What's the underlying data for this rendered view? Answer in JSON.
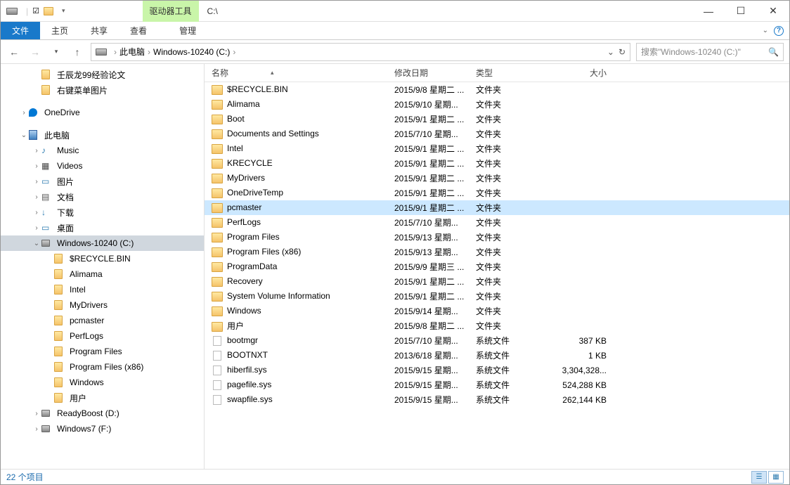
{
  "title": "C:\\",
  "tools_tab": "驱动器工具",
  "ribbon": {
    "file": "文件",
    "home": "主页",
    "share": "共享",
    "view": "查看",
    "manage": "管理"
  },
  "breadcrumb": {
    "pc": "此电脑",
    "drive": "Windows-10240 (C:)"
  },
  "search_placeholder": "搜索\"Windows-10240 (C:)\"",
  "columns": {
    "name": "名称",
    "date": "修改日期",
    "type": "类型",
    "size": "大小"
  },
  "tree": [
    {
      "indent": 2,
      "icon": "folder",
      "label": "壬辰龙99经验论文"
    },
    {
      "indent": 2,
      "icon": "folder",
      "label": "右键菜单图片"
    },
    {
      "spacer": true
    },
    {
      "indent": 1,
      "icon": "od",
      "label": "OneDrive",
      "expander": ">"
    },
    {
      "spacer": true
    },
    {
      "indent": 1,
      "icon": "pc",
      "label": "此电脑",
      "expander": "v"
    },
    {
      "indent": 2,
      "icon": "music",
      "label": "Music",
      "expander": ">"
    },
    {
      "indent": 2,
      "icon": "video",
      "label": "Videos",
      "expander": ">"
    },
    {
      "indent": 2,
      "icon": "pic",
      "label": "图片",
      "expander": ">"
    },
    {
      "indent": 2,
      "icon": "doc",
      "label": "文档",
      "expander": ">"
    },
    {
      "indent": 2,
      "icon": "dl",
      "label": "下载",
      "expander": ">"
    },
    {
      "indent": 2,
      "icon": "desk",
      "label": "桌面",
      "expander": ">"
    },
    {
      "indent": 2,
      "icon": "drive",
      "label": "Windows-10240 (C:)",
      "expander": "v",
      "selected": true
    },
    {
      "indent": 3,
      "icon": "folder",
      "label": "$RECYCLE.BIN"
    },
    {
      "indent": 3,
      "icon": "folder",
      "label": "Alimama"
    },
    {
      "indent": 3,
      "icon": "folder",
      "label": "Intel"
    },
    {
      "indent": 3,
      "icon": "folder",
      "label": "MyDrivers"
    },
    {
      "indent": 3,
      "icon": "folder",
      "label": "pcmaster"
    },
    {
      "indent": 3,
      "icon": "folder",
      "label": "PerfLogs"
    },
    {
      "indent": 3,
      "icon": "folder",
      "label": "Program Files"
    },
    {
      "indent": 3,
      "icon": "folder",
      "label": "Program Files (x86)"
    },
    {
      "indent": 3,
      "icon": "folder",
      "label": "Windows"
    },
    {
      "indent": 3,
      "icon": "folder",
      "label": "用户"
    },
    {
      "indent": 2,
      "icon": "drive",
      "label": "ReadyBoost (D:)",
      "expander": ">"
    },
    {
      "indent": 2,
      "icon": "drive",
      "label": "Windows7 (F:)",
      "expander": ">"
    }
  ],
  "files": [
    {
      "icon": "folder",
      "name": "$RECYCLE.BIN",
      "date": "2015/9/8 星期二 ...",
      "type": "文件夹",
      "size": ""
    },
    {
      "icon": "folder",
      "name": "Alimama",
      "date": "2015/9/10 星期...",
      "type": "文件夹",
      "size": ""
    },
    {
      "icon": "folder",
      "name": "Boot",
      "date": "2015/9/1 星期二 ...",
      "type": "文件夹",
      "size": ""
    },
    {
      "icon": "folder",
      "name": "Documents and Settings",
      "date": "2015/7/10 星期...",
      "type": "文件夹",
      "size": ""
    },
    {
      "icon": "folder",
      "name": "Intel",
      "date": "2015/9/1 星期二 ...",
      "type": "文件夹",
      "size": ""
    },
    {
      "icon": "folder",
      "name": "KRECYCLE",
      "date": "2015/9/1 星期二 ...",
      "type": "文件夹",
      "size": ""
    },
    {
      "icon": "folder",
      "name": "MyDrivers",
      "date": "2015/9/1 星期二 ...",
      "type": "文件夹",
      "size": ""
    },
    {
      "icon": "folder",
      "name": "OneDriveTemp",
      "date": "2015/9/1 星期二 ...",
      "type": "文件夹",
      "size": ""
    },
    {
      "icon": "folder",
      "name": "pcmaster",
      "date": "2015/9/1 星期二 ...",
      "type": "文件夹",
      "size": "",
      "selected": true
    },
    {
      "icon": "folder",
      "name": "PerfLogs",
      "date": "2015/7/10 星期...",
      "type": "文件夹",
      "size": ""
    },
    {
      "icon": "folder",
      "name": "Program Files",
      "date": "2015/9/13 星期...",
      "type": "文件夹",
      "size": ""
    },
    {
      "icon": "folder",
      "name": "Program Files (x86)",
      "date": "2015/9/13 星期...",
      "type": "文件夹",
      "size": ""
    },
    {
      "icon": "folder",
      "name": "ProgramData",
      "date": "2015/9/9 星期三 ...",
      "type": "文件夹",
      "size": ""
    },
    {
      "icon": "folder",
      "name": "Recovery",
      "date": "2015/9/1 星期二 ...",
      "type": "文件夹",
      "size": ""
    },
    {
      "icon": "folder",
      "name": "System Volume Information",
      "date": "2015/9/1 星期二 ...",
      "type": "文件夹",
      "size": ""
    },
    {
      "icon": "folder",
      "name": "Windows",
      "date": "2015/9/14 星期...",
      "type": "文件夹",
      "size": ""
    },
    {
      "icon": "folder",
      "name": "用户",
      "date": "2015/9/8 星期二 ...",
      "type": "文件夹",
      "size": ""
    },
    {
      "icon": "file",
      "name": "bootmgr",
      "date": "2015/7/10 星期...",
      "type": "系统文件",
      "size": "387 KB"
    },
    {
      "icon": "file",
      "name": "BOOTNXT",
      "date": "2013/6/18 星期...",
      "type": "系统文件",
      "size": "1 KB"
    },
    {
      "icon": "file",
      "name": "hiberfil.sys",
      "date": "2015/9/15 星期...",
      "type": "系统文件",
      "size": "3,304,328..."
    },
    {
      "icon": "file",
      "name": "pagefile.sys",
      "date": "2015/9/15 星期...",
      "type": "系统文件",
      "size": "524,288 KB"
    },
    {
      "icon": "file",
      "name": "swapfile.sys",
      "date": "2015/9/15 星期...",
      "type": "系统文件",
      "size": "262,144 KB"
    }
  ],
  "status": "22 个项目"
}
